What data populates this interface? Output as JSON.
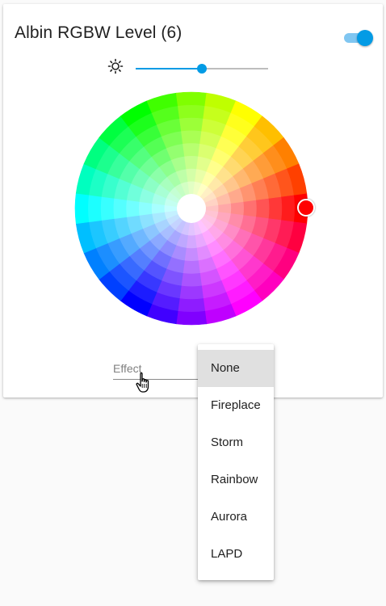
{
  "card": {
    "title": "Albin RGBW Level (6)",
    "toggle_on": true
  },
  "brightness": {
    "icon": "brightness-icon",
    "value_fraction": 0.5
  },
  "color_picker": {
    "selected_color": "#ff0000",
    "hue_degrees": 0
  },
  "effect": {
    "label": "Effect",
    "options": [
      {
        "label": "None",
        "selected": true
      },
      {
        "label": "Fireplace",
        "selected": false
      },
      {
        "label": "Storm",
        "selected": false
      },
      {
        "label": "Rainbow",
        "selected": false
      },
      {
        "label": "Aurora",
        "selected": false
      },
      {
        "label": "LAPD",
        "selected": false
      }
    ]
  },
  "colors": {
    "accent": "#039be5",
    "accent_light": "#80c6f1",
    "page_background": "#fafafa",
    "menu_highlight": "#e0e0e0"
  }
}
